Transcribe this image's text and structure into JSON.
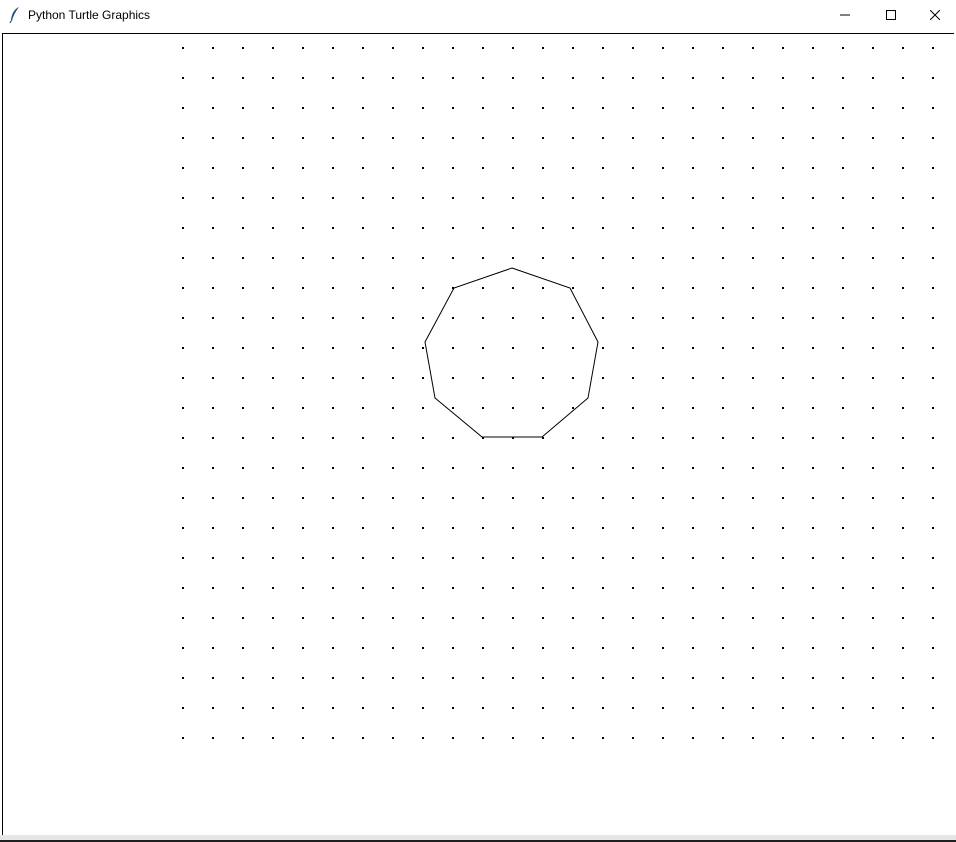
{
  "window": {
    "title": "Python Turtle Graphics",
    "icon": "feather-icon",
    "controls": {
      "minimize": "minimize-icon",
      "maximize": "maximize-icon",
      "close": "close-icon"
    }
  },
  "canvas": {
    "background": "#ffffff",
    "dot_color": "#000000",
    "stroke_color": "#000000",
    "dot_grid": {
      "columns": 26,
      "rows": 24
    },
    "shape": {
      "type": "nonagon",
      "sides": 9
    }
  }
}
